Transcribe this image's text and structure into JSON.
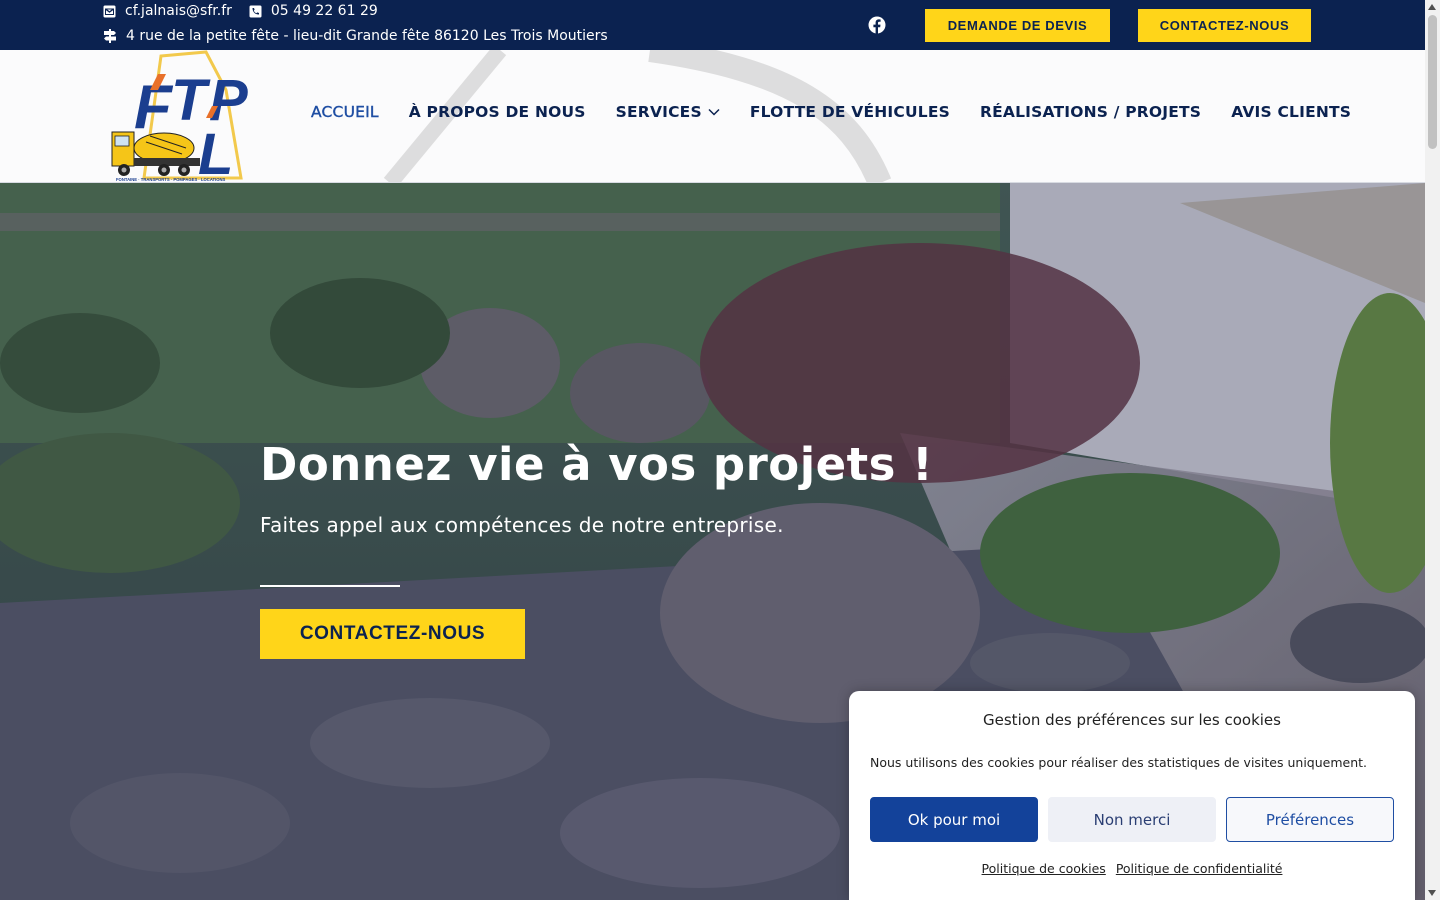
{
  "topbar": {
    "email": "cf.jalnais@sfr.fr",
    "phone": "05 49 22 61 29",
    "address": "4 rue de la petite fête - lieu-dit Grande fête 86120 Les Trois Moutiers",
    "devis_label": "DEMANDE DE DEVIS",
    "contact_label": "CONTACTEZ-NOUS"
  },
  "logo": {
    "text": "FTP L",
    "tagline": "FONTAINE · TRANSPORTS · POMPAGES · LOCATIONS"
  },
  "nav": {
    "items": [
      {
        "label": "ACCUEIL"
      },
      {
        "label": "À PROPOS DE NOUS"
      },
      {
        "label": "SERVICES"
      },
      {
        "label": "FLOTTE DE VÉHICULES"
      },
      {
        "label": "RÉALISATIONS / PROJETS"
      },
      {
        "label": "AVIS CLIENTS"
      }
    ]
  },
  "hero": {
    "title": "Donnez vie à vos projets !",
    "subtitle": "Faites appel aux compétences de notre entreprise.",
    "cta_label": "CONTACTEZ-NOUS"
  },
  "cookie": {
    "title": "Gestion des préférences sur les cookies",
    "message": "Nous utilisons des cookies pour réaliser des statistiques de visites uniquement.",
    "accept_label": "Ok pour moi",
    "deny_label": "Non merci",
    "prefs_label": "Préférences",
    "cookie_policy_label": "Politique de cookies",
    "privacy_policy_label": "Politique de confidentialité"
  },
  "colors": {
    "navy": "#0b2250",
    "accent_yellow": "#ffd519",
    "primary_blue": "#13429a"
  }
}
